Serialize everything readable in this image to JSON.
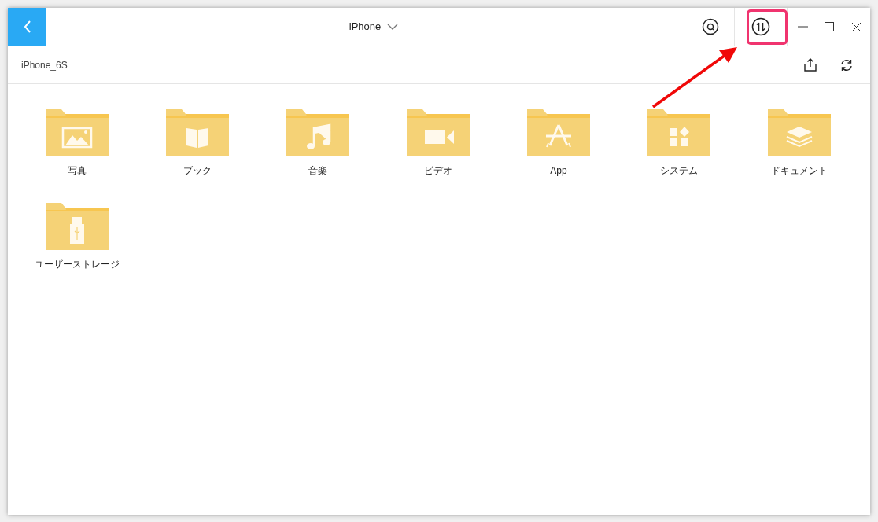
{
  "window": {
    "title": "iPhone"
  },
  "breadcrumb": "iPhone_6S",
  "folders": [
    {
      "label": "写真",
      "kind": "photo"
    },
    {
      "label": "ブック",
      "kind": "book"
    },
    {
      "label": "音楽",
      "kind": "music"
    },
    {
      "label": "ビデオ",
      "kind": "video"
    },
    {
      "label": "App",
      "kind": "app"
    },
    {
      "label": "システム",
      "kind": "system"
    },
    {
      "label": "ドキュメント",
      "kind": "document"
    },
    {
      "label": "ユーザーストレージ",
      "kind": "usb"
    }
  ]
}
